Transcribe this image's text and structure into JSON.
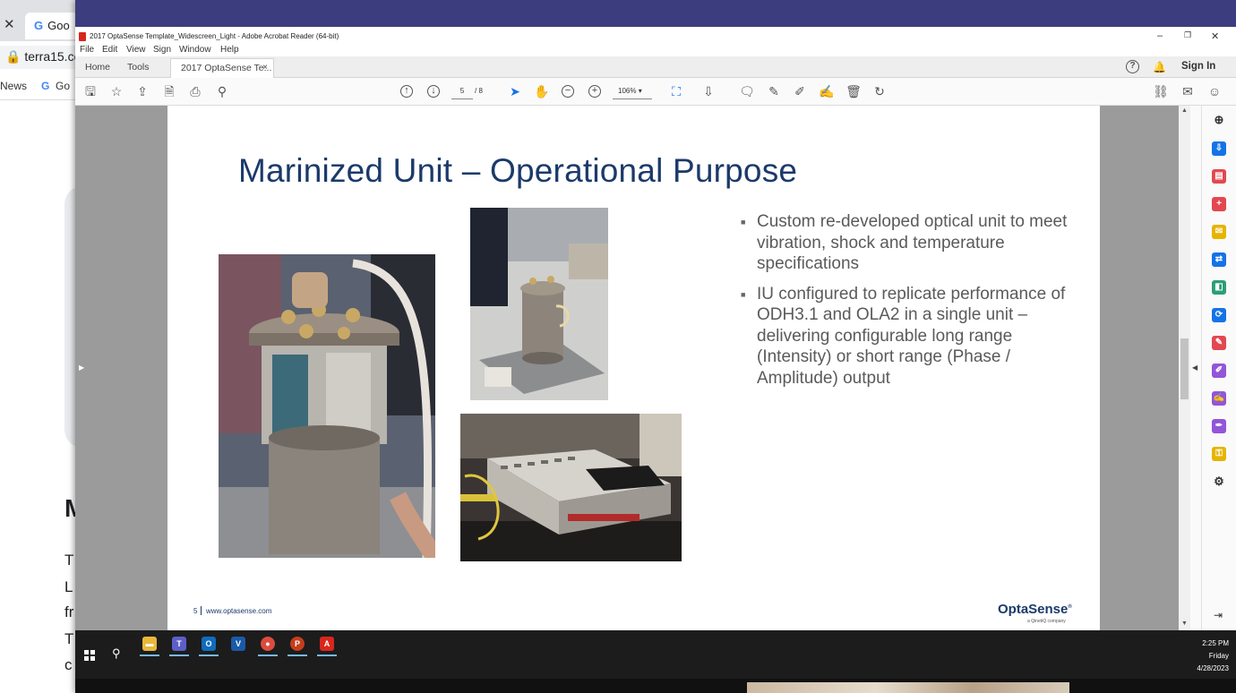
{
  "browser": {
    "tab_label": "Goo",
    "address_text": "terra15.co",
    "bookmark_news": "News",
    "bookmark_google": "Go",
    "content_heading": "M",
    "content_lines": [
      "T",
      "L",
      "fr",
      "T",
      "c"
    ]
  },
  "acrobat": {
    "window_title": "2017 OptaSense Template_Widescreen_Light - Adobe Acrobat Reader (64-bit)",
    "window_controls": {
      "minimize": "–",
      "restore": "❐",
      "close": "✕"
    },
    "menu": [
      "File",
      "Edit",
      "View",
      "Sign",
      "Window",
      "Help"
    ],
    "tabs": {
      "home": "Home",
      "tools": "Tools",
      "document": "2017 OptaSense Te...",
      "document_close": "×"
    },
    "help": "?",
    "sign_in": "Sign In",
    "page_current": "5",
    "page_total": "/ 8",
    "zoom": "106%"
  },
  "slide": {
    "title": "Marinized Unit – Operational Purpose",
    "bullets": [
      "Custom re-developed optical unit to meet vibration, shock and temperature specifications",
      "IU configured to replicate performance of ODH3.1 and OLA2 in a single unit – delivering configurable long range (Intensity) or short range (Phase / Amplitude) output"
    ],
    "footer_page": "5",
    "footer_url": "www.optasense.com",
    "logo": "OptaSense",
    "logo_mark": "®",
    "logo_sub": "a QinetiQ company"
  },
  "taskbar": {
    "time": "2:25 PM",
    "day": "Friday",
    "date": "4/28/2023"
  },
  "colors": {
    "title_blue": "#1b3a6a",
    "top_band": "#3c3d7e",
    "pdf_red": "#d9261c"
  }
}
